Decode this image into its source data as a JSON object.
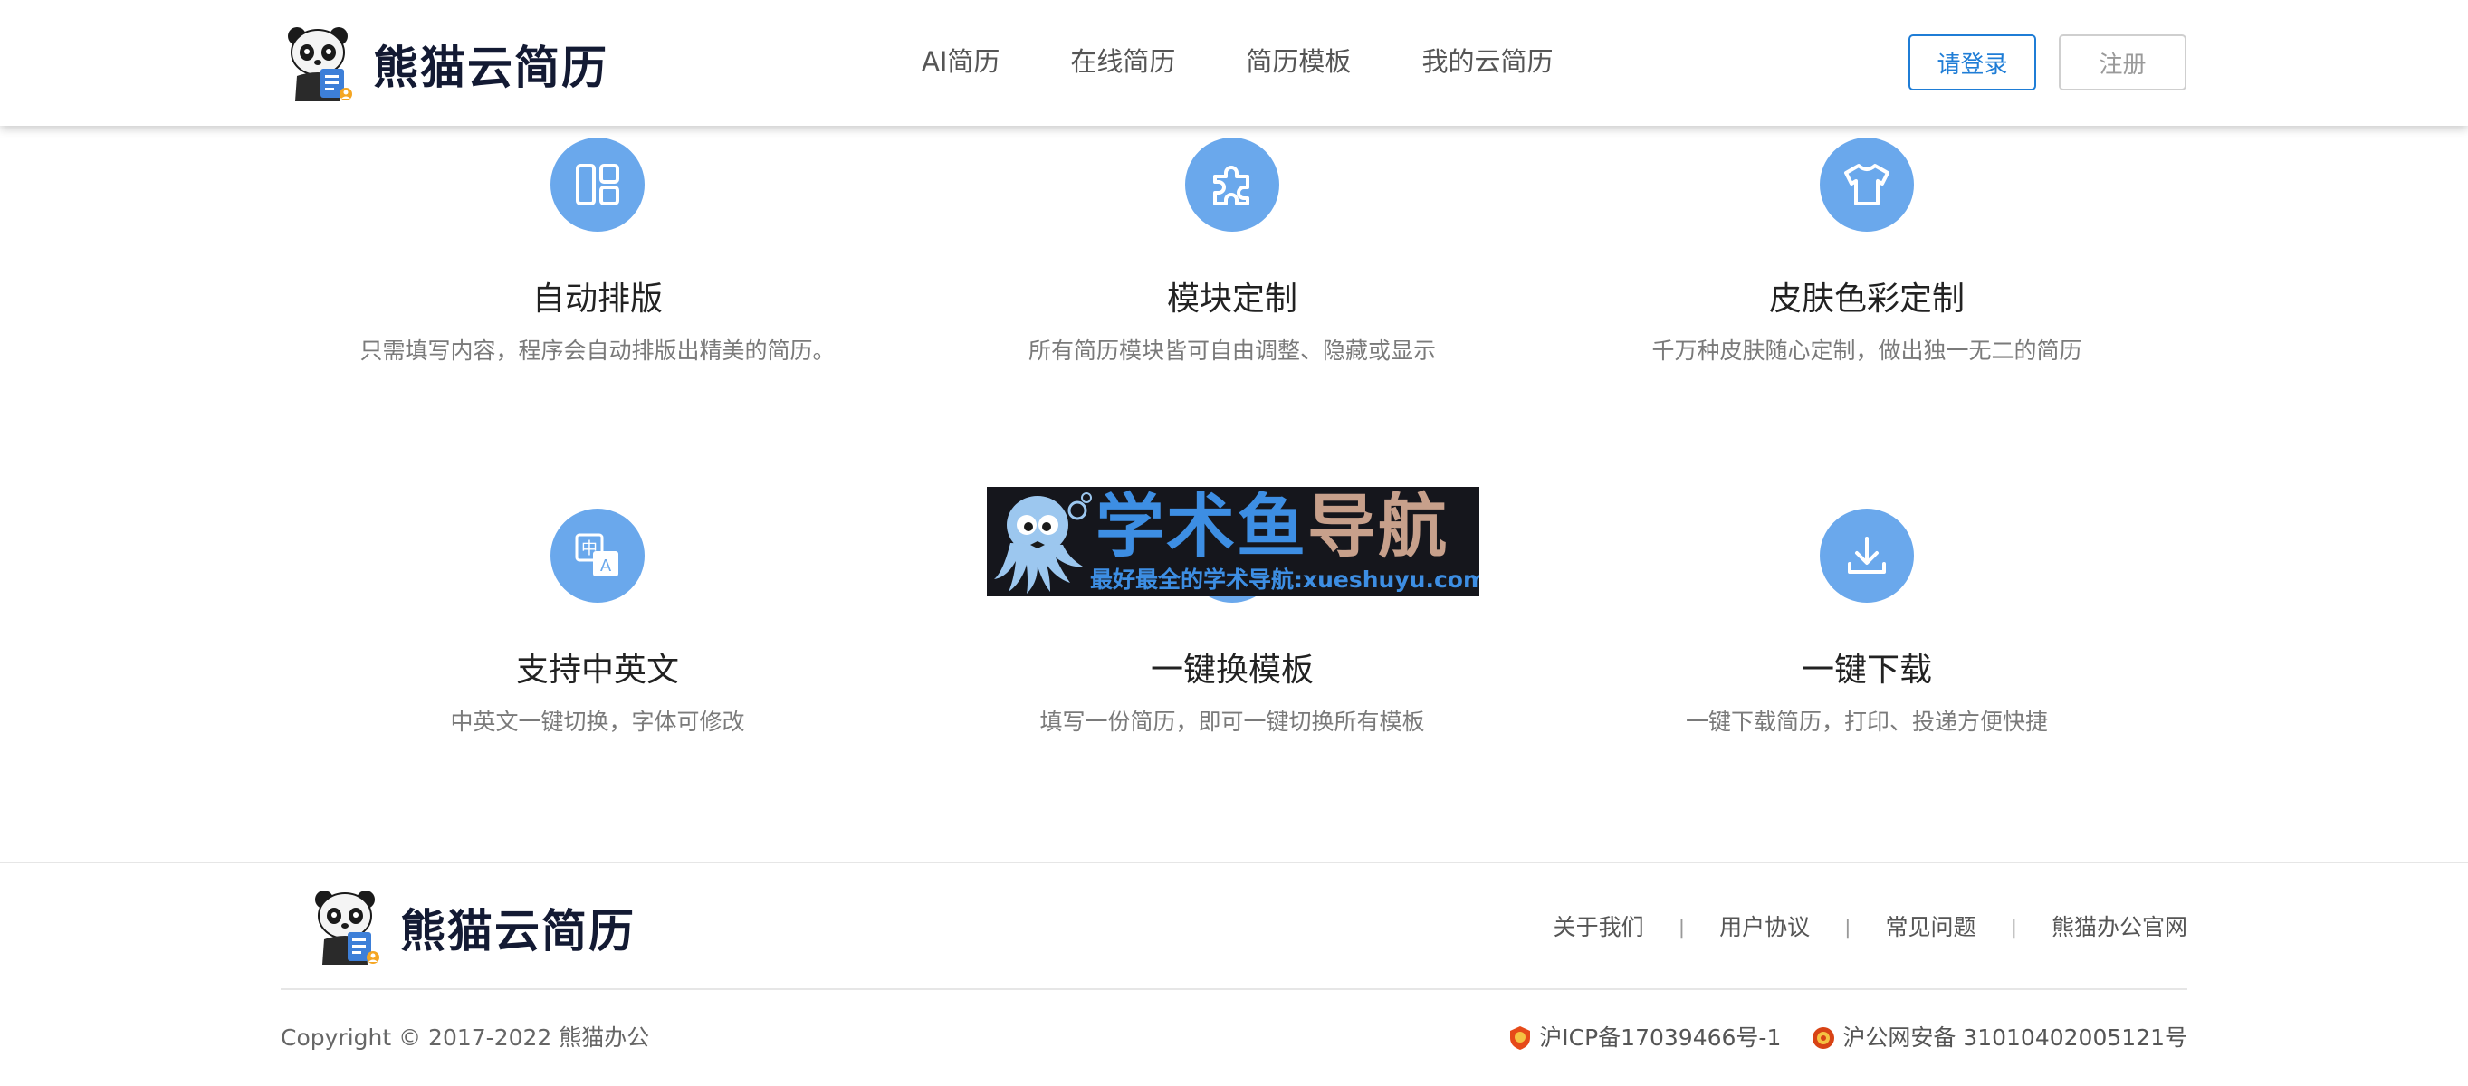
{
  "header": {
    "brand": "熊猫云简历",
    "nav": [
      "AI简历",
      "在线简历",
      "简历模板",
      "我的云简历"
    ],
    "login_label": "请登录",
    "register_label": "注册"
  },
  "features": [
    {
      "icon": "layout-icon",
      "title": "自动排版",
      "desc": "只需填写内容，程序会自动排版出精美的简历。"
    },
    {
      "icon": "puzzle-icon",
      "title": "模块定制",
      "desc": "所有简历模块皆可自由调整、隐藏或显示"
    },
    {
      "icon": "tshirt-icon",
      "title": "皮肤色彩定制",
      "desc": "千万种皮肤随心定制，做出独一无二的简历"
    },
    {
      "icon": "translate-icon",
      "title": "支持中英文",
      "desc": "中英文一键切换，字体可修改"
    },
    {
      "icon": "switch-template-icon",
      "title": "一键换模板",
      "desc": "填写一份简历，即可一键切换所有模板"
    },
    {
      "icon": "download-icon",
      "title": "一键下载",
      "desc": "一键下载简历，打印、投递方便快捷"
    }
  ],
  "watermark": {
    "title_part1": "学术鱼",
    "title_part2": "导航",
    "subtitle": "最好最全的学术导航:xueshuyu.com"
  },
  "footer": {
    "brand": "熊猫云简历",
    "links": [
      "关于我们",
      "用户协议",
      "常见问题",
      "熊猫办公官网"
    ],
    "separator": "|",
    "copyright": "Copyright © 2017-2022 熊猫办公",
    "icp": "沪ICP备17039466号-1",
    "police": "沪公网安备 31010402005121号"
  },
  "colors": {
    "accent": "#1f7dd6",
    "icon_circle": "#6aa8ec",
    "brand_text": "#131a33"
  }
}
